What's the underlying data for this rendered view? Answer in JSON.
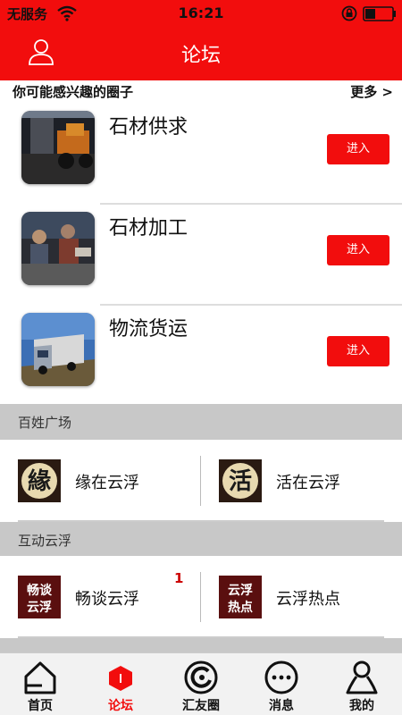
{
  "status": {
    "carrier": "无服务",
    "time": "16:21"
  },
  "header": {
    "title": "论坛"
  },
  "recommend": {
    "title": "你可能感兴趣的圈子",
    "more": "更多 >",
    "items": [
      {
        "name": "石材供求",
        "button": "进入",
        "thumb": "stone-supply-photo"
      },
      {
        "name": "石材加工",
        "button": "进入",
        "thumb": "stone-processing-photo"
      },
      {
        "name": "物流货运",
        "button": "进入",
        "thumb": "logistics-truck-photo"
      }
    ]
  },
  "sections": [
    {
      "title": "百姓广场",
      "items": [
        {
          "label": "缘在云浮",
          "icon_text": "緣",
          "icon": "yuan-calligraphy-icon"
        },
        {
          "label": "活在云浮",
          "icon_text": "活",
          "icon": "huo-calligraphy-icon"
        }
      ]
    },
    {
      "title": "互动云浮",
      "badge": "1",
      "items": [
        {
          "label": "畅谈云浮",
          "icon_text": "畅谈云浮",
          "icon": "changtan-icon"
        },
        {
          "label": "云浮热点",
          "icon_text": "云浮热点",
          "icon": "hotspot-icon"
        }
      ]
    }
  ],
  "tabbar": {
    "active_index": 1,
    "active_color": "#f20d0d",
    "items": [
      {
        "label": "首页",
        "icon": "home-icon"
      },
      {
        "label": "论坛",
        "icon": "forum-icon"
      },
      {
        "label": "汇友圈",
        "icon": "friends-circle-icon"
      },
      {
        "label": "消息",
        "icon": "message-icon"
      },
      {
        "label": "我的",
        "icon": "profile-icon"
      }
    ]
  },
  "colors": {
    "brand_red": "#f20d0d",
    "section_gray": "#c8c8c8"
  }
}
